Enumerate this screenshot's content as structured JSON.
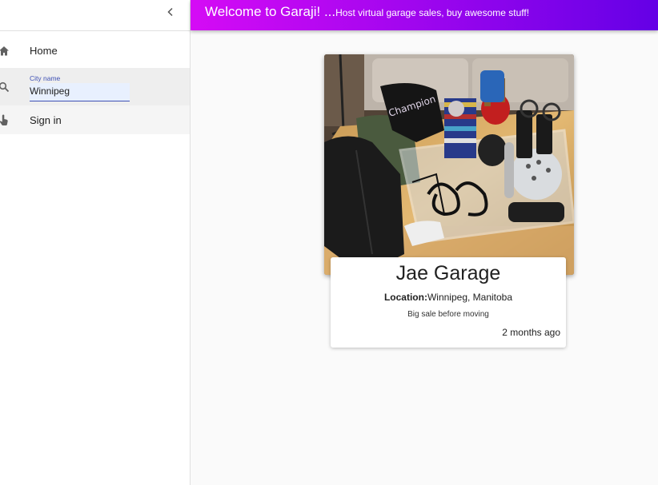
{
  "header": {
    "title": "Welcome to Garaji! ...",
    "subtitle": "Host virtual garage sales, buy awesome stuff!"
  },
  "sidebar": {
    "collapse_icon": "chevron-left-icon",
    "items": [
      {
        "label": "Home",
        "icon": "home-icon"
      },
      {
        "label": "City name",
        "value": "Winnipeg",
        "icon": "search-icon"
      },
      {
        "label": "Sign in",
        "icon": "touch-app-icon"
      }
    ]
  },
  "listing": {
    "title": "Jae Garage",
    "location_label": "Location:",
    "location": "Winnipeg, Manitoba",
    "description": "Big sale before moving",
    "time": "2 months ago"
  },
  "colors": {
    "appbar_start": "#d50bf5",
    "appbar_end": "#6400e6",
    "input_accent": "#3f51b5"
  }
}
